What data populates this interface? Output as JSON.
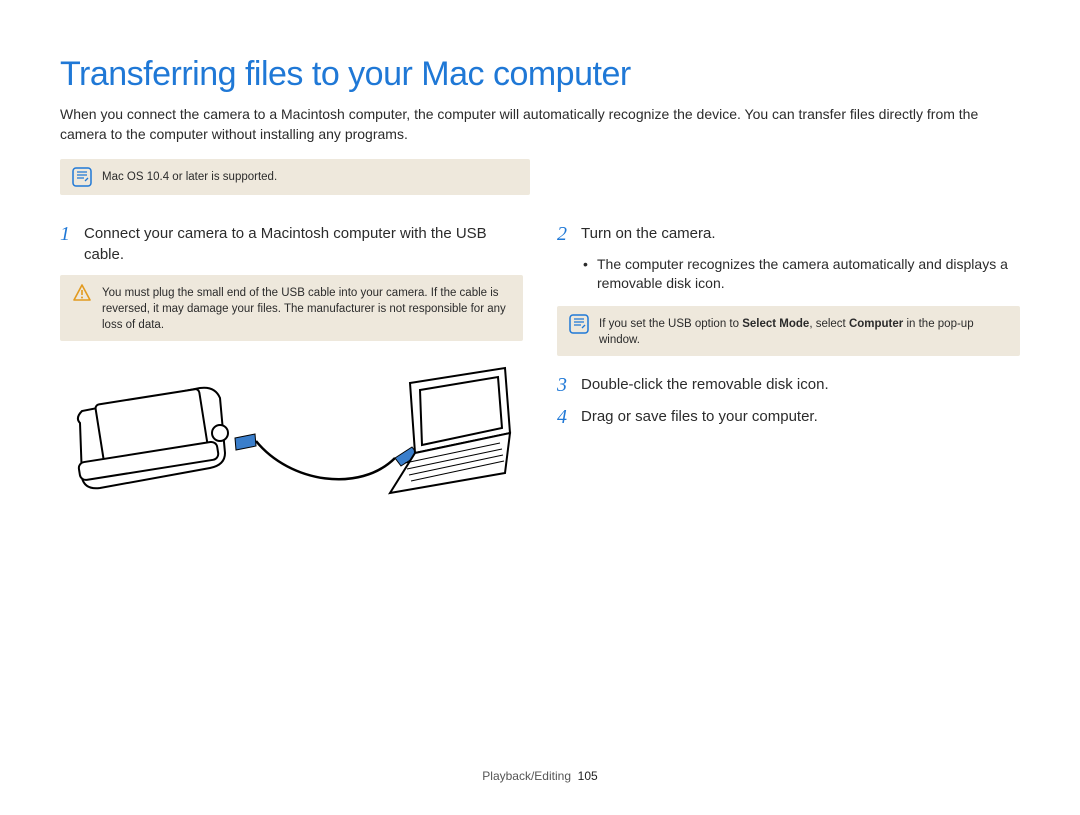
{
  "title": "Transferring files to your Mac computer",
  "intro": "When you connect the camera to a Macintosh computer, the computer will automatically recognize the device. You can transfer files directly from the camera to the computer without installing any programs.",
  "top_note": "Mac OS 10.4 or later is supported.",
  "left": {
    "step1_num": "1",
    "step1_text": "Connect your camera to a Macintosh computer with the USB cable.",
    "warning": "You must plug the small end of the USB cable into your camera. If the cable is reversed, it may damage your files. The manufacturer is not responsible for any loss of data."
  },
  "right": {
    "step2_num": "2",
    "step2_text": "Turn on the camera.",
    "step2_bullet": "The computer recognizes the camera automatically and displays a removable disk icon.",
    "note_prefix": "If you set the USB option to ",
    "note_bold1": "Select Mode",
    "note_mid": ", select ",
    "note_bold2": "Computer",
    "note_suffix": " in the pop-up window.",
    "step3_num": "3",
    "step3_text": "Double-click the removable disk icon.",
    "step4_num": "4",
    "step4_text": "Drag or save files to your computer."
  },
  "footer_section": "Playback/Editing",
  "footer_page": "105"
}
